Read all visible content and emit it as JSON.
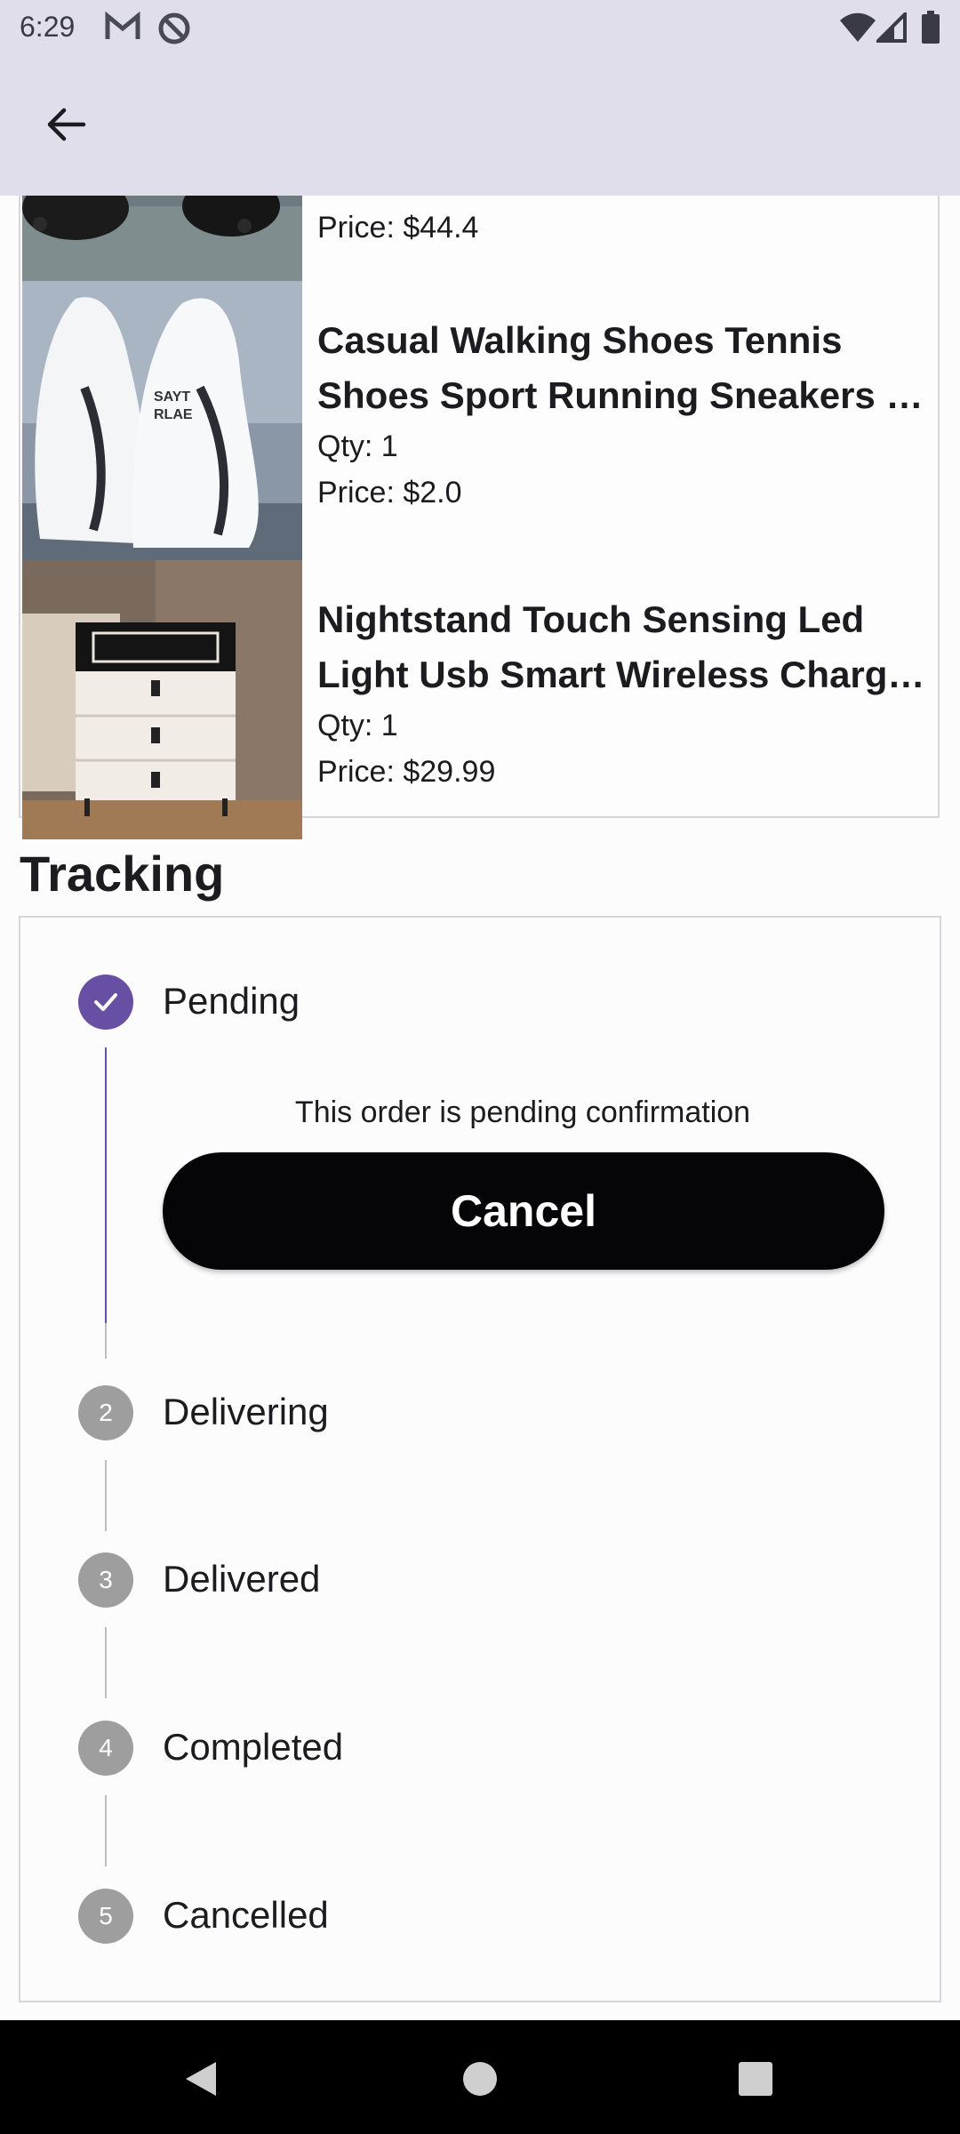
{
  "status_bar": {
    "time": "6:29",
    "icons": [
      "gmail-icon",
      "do-not-disturb-icon",
      "wifi-icon",
      "cellular-signal-icon",
      "battery-icon"
    ]
  },
  "app_bar": {
    "back_icon": "arrow-back-icon"
  },
  "order_items": [
    {
      "name": "",
      "qty": "",
      "price": "Price: $44.4",
      "image": "black-shoe-photo"
    },
    {
      "name": "Casual Walking Shoes Tennis Shoes Sport Running Sneakers …",
      "qty": "Qty: 1",
      "price": "Price: $2.0",
      "image": "white-sneakers-photo"
    },
    {
      "name": "Nightstand Touch Sensing Led Light Usb Smart Wireless Charg…",
      "qty": "Qty: 1",
      "price": "Price: $29.99",
      "image": "nightstand-photo"
    }
  ],
  "tracking": {
    "title": "Tracking",
    "steps": [
      {
        "number": "",
        "label": "Pending",
        "state": "completed"
      },
      {
        "number": "2",
        "label": "Delivering",
        "state": "upcoming"
      },
      {
        "number": "3",
        "label": "Delivered",
        "state": "upcoming"
      },
      {
        "number": "4",
        "label": "Completed",
        "state": "upcoming"
      },
      {
        "number": "5",
        "label": "Cancelled",
        "state": "upcoming"
      }
    ],
    "pending_message": "This order is pending confirmation",
    "cancel_label": "Cancel"
  },
  "colors": {
    "accent": "#6750a4",
    "app_bar": "#dfdeea",
    "button": "#050507",
    "inactive_step": "#9e9e9e"
  },
  "nav_bar": {
    "icons": [
      "back-triangle-icon",
      "home-circle-icon",
      "recents-square-icon"
    ]
  }
}
